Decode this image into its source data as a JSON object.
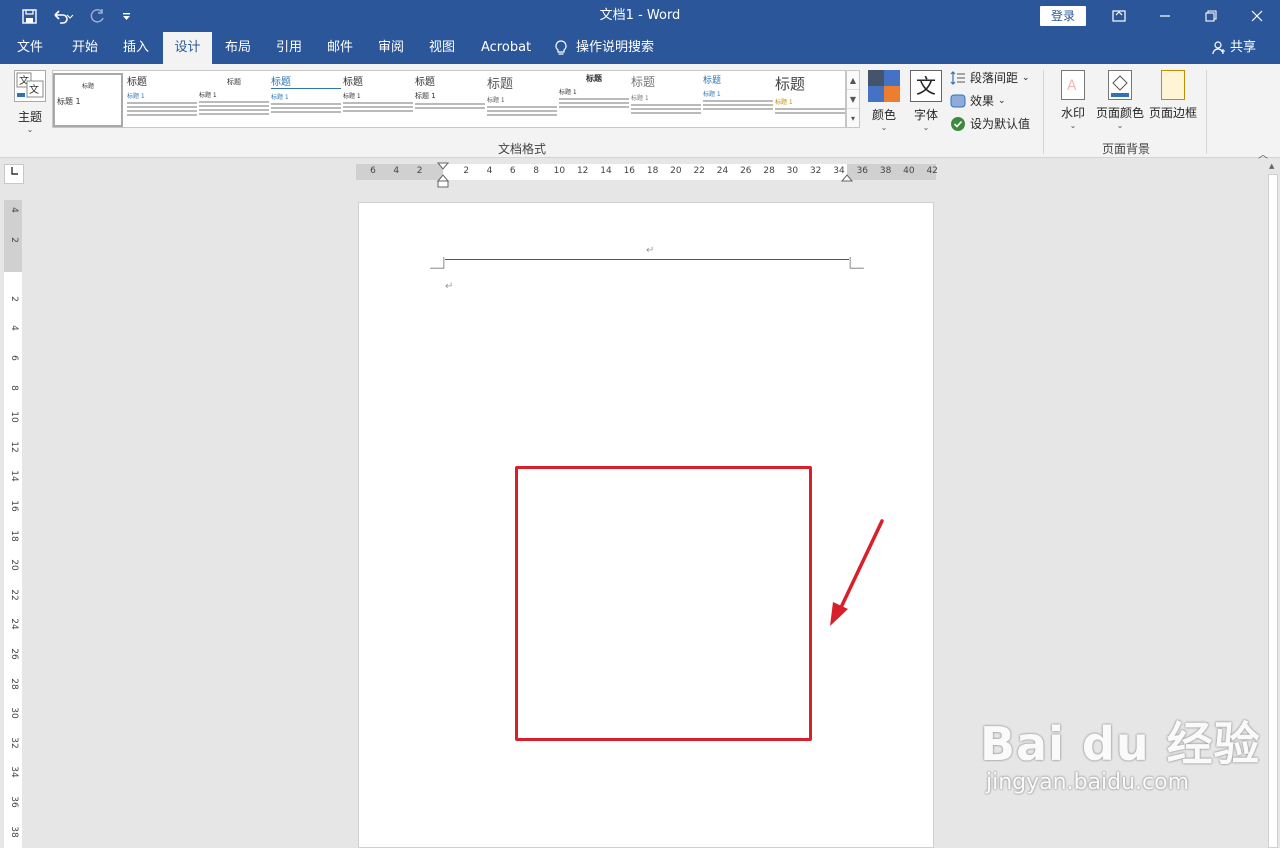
{
  "titlebar": {
    "title": "文档1  -  Word",
    "login": "登录",
    "icons": [
      "save-icon",
      "undo-icon",
      "redo-icon",
      "customize-qat-icon"
    ]
  },
  "tabs": [
    {
      "label": "文件"
    },
    {
      "label": "开始"
    },
    {
      "label": "插入"
    },
    {
      "label": "设计"
    },
    {
      "label": "布局"
    },
    {
      "label": "引用"
    },
    {
      "label": "邮件"
    },
    {
      "label": "审阅"
    },
    {
      "label": "视图"
    },
    {
      "label": "Acrobat"
    }
  ],
  "active_tab": "设计",
  "tell_me": "操作说明搜索",
  "share": "共享",
  "ribbon": {
    "theme_label": "主题",
    "gallery_styles": [
      {
        "heading": "标题",
        "sub": "标题 1"
      },
      {
        "heading": "标题",
        "sub": "标题 1"
      },
      {
        "heading": "标题",
        "sub": "标题 1"
      },
      {
        "heading": "标题",
        "sub": "标题 1"
      },
      {
        "heading": "标题",
        "sub": "标题 1"
      },
      {
        "heading": "标题",
        "sub": "标题 1"
      },
      {
        "heading": "标题",
        "sub": "标题 1"
      },
      {
        "heading": "标题",
        "sub": "标题 1"
      },
      {
        "heading": "标题",
        "sub": "标题 1"
      },
      {
        "heading": "标题",
        "sub": "标题 1"
      },
      {
        "heading": "标题",
        "sub": "标题 1"
      }
    ],
    "group_doc_format": "文档格式",
    "colors_label": "颜色",
    "fonts_label": "字体",
    "fonts_icon_char": "文",
    "paragraph_spacing": "段落间距",
    "effects": "效果",
    "set_default": "设为默认值",
    "watermark_label": "水印",
    "page_color_label": "页面颜色",
    "page_border_label": "页面边框",
    "group_page_bg": "页面背景",
    "accent": "#2b579a"
  },
  "ruler": {
    "h_ticks": [
      "6",
      "4",
      "2",
      "",
      "2",
      "4",
      "6",
      "8",
      "10",
      "12",
      "14",
      "16",
      "18",
      "20",
      "22",
      "24",
      "26",
      "28",
      "30",
      "32",
      "34",
      "36",
      "38",
      "40",
      "42"
    ],
    "v_ticks": [
      "4",
      "2",
      "",
      "2",
      "4",
      "6",
      "8",
      "10",
      "12",
      "14",
      "16",
      "18",
      "20",
      "22",
      "24",
      "26",
      "28",
      "30",
      "32",
      "34",
      "36",
      "38"
    ]
  },
  "document": {
    "para_mark": "↵",
    "highlight_color": "#d9202a"
  },
  "watermark": {
    "brand": "Bai du 经验",
    "url": "jingyan.baidu.com"
  }
}
